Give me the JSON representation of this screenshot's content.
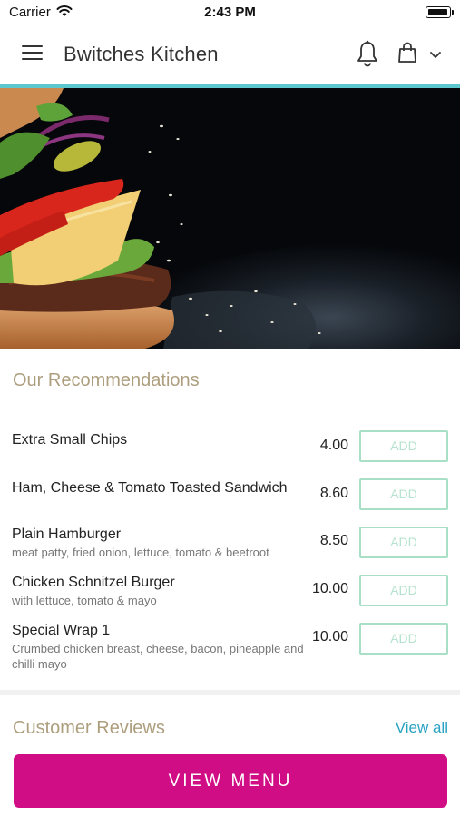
{
  "status_bar": {
    "carrier": "Carrier",
    "time": "2:43 PM",
    "icons": [
      "wifi-icon",
      "battery-icon"
    ]
  },
  "header": {
    "title": "Bwitches Kitchen",
    "icons": [
      "menu-icon",
      "bell-icon",
      "bag-icon",
      "chevron-down-icon"
    ],
    "accent_color": "#5cc7cc"
  },
  "recommendations": {
    "title": "Our Recommendations",
    "items": [
      {
        "name": "Extra Small Chips",
        "description": "",
        "price": "4.00",
        "add_label": "ADD"
      },
      {
        "name": "Ham, Cheese & Tomato Toasted Sandwich",
        "description": "",
        "price": "8.60",
        "add_label": "ADD"
      },
      {
        "name": "Plain Hamburger",
        "description": "meat patty, fried onion, lettuce, tomato & beetroot",
        "price": "8.50",
        "add_label": "ADD"
      },
      {
        "name": "Chicken Schnitzel Burger",
        "description": "with lettuce, tomato & mayo",
        "price": "10.00",
        "add_label": "ADD"
      },
      {
        "name": "Special Wrap 1",
        "description": "Crumbed chicken breast, cheese, bacon, pineapple and chilli mayo",
        "price": "10.00",
        "add_label": "ADD"
      }
    ]
  },
  "reviews": {
    "title": "Customer Reviews",
    "view_all_label": "View all"
  },
  "cta": {
    "label": "VIEW MENU",
    "color": "#d10d86"
  },
  "colors": {
    "section_title": "#ad9e7e",
    "add_border": "#a8dfc6",
    "link": "#2aa3c2"
  }
}
